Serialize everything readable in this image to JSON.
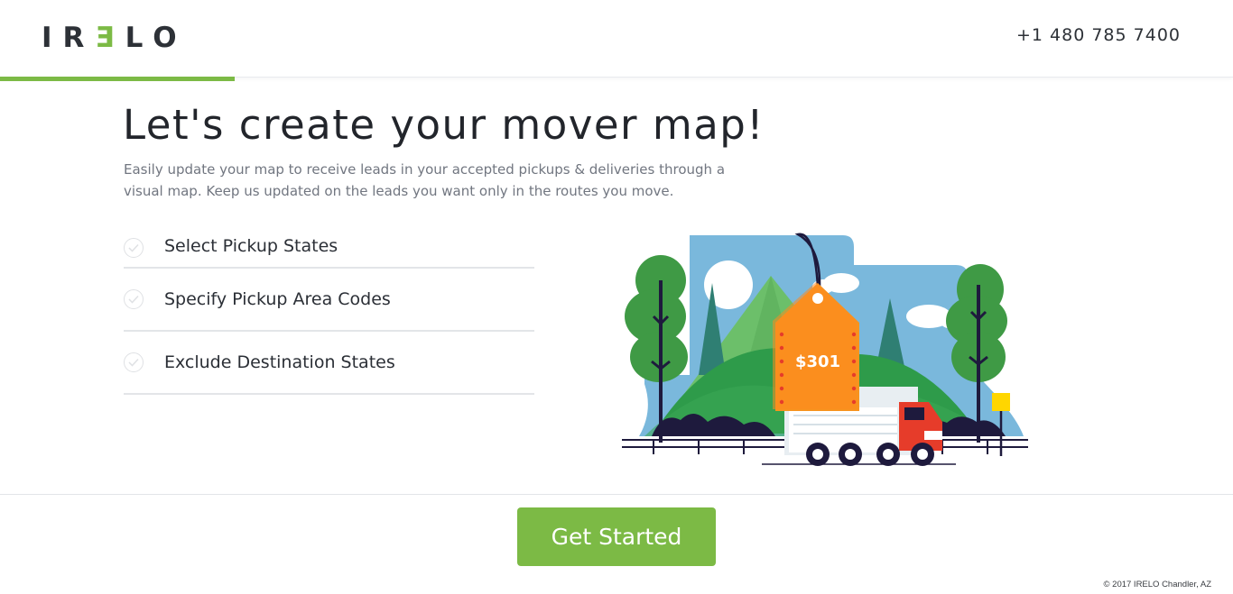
{
  "header": {
    "logo_text": "IRELO",
    "phone": "+1 480 785 7400"
  },
  "progress": {
    "fraction": 0.19
  },
  "main": {
    "title": "Let's create your mover map!",
    "subtitle": "Easily update your map to receive leads in your accepted pickups & deliveries through a visual map. Keep us updated on the leads you want only in the routes you move.",
    "steps": [
      {
        "label": "Select Pickup States"
      },
      {
        "label": "Specify Pickup Area Codes"
      },
      {
        "label": "Exclude Destination States"
      }
    ]
  },
  "illustration": {
    "price_tag": "$301",
    "icon": "moving-truck-illustration"
  },
  "cta": {
    "label": "Get Started"
  },
  "footer": {
    "copyright": "© 2017 IRELO Chandler, AZ"
  },
  "colors": {
    "brand_green": "#7cba45",
    "tag_orange": "#f7931e",
    "sky_blue": "#7ab8dc",
    "text_dark": "#22252b",
    "text_muted": "#717680"
  }
}
